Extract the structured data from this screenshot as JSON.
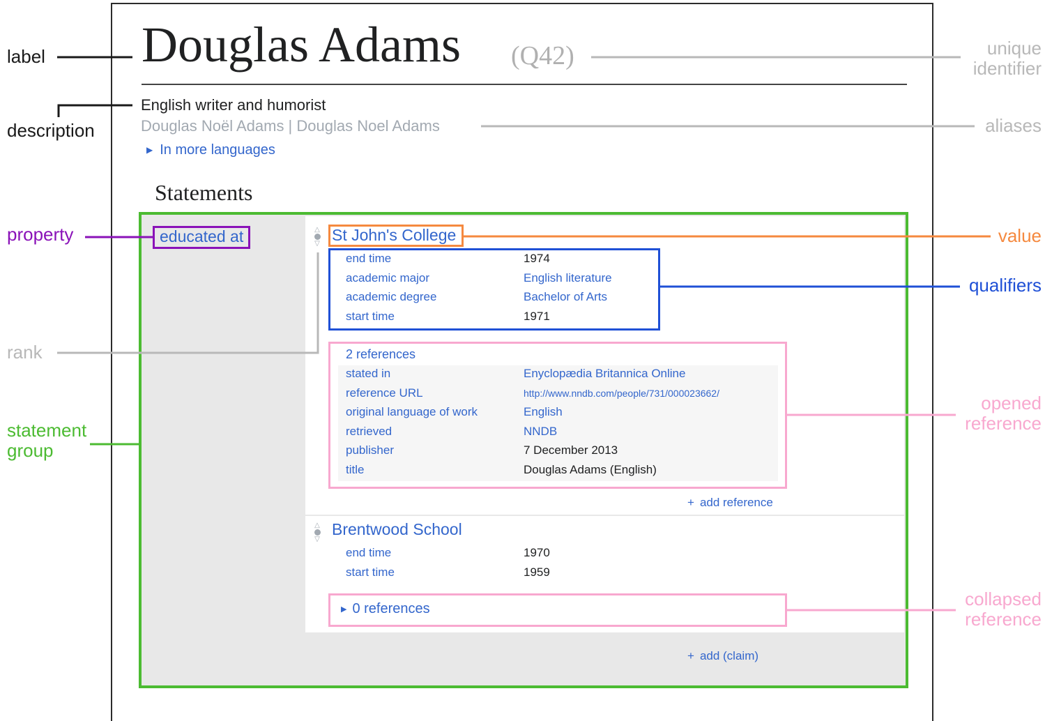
{
  "header": {
    "label": "Douglas Adams",
    "id": "(Q42)",
    "description": "English writer and humorist",
    "aliases": "Douglas Noël Adams | Douglas Noel Adams",
    "more_languages": "In more languages",
    "statements_heading": "Statements"
  },
  "statement_group": {
    "property": "educated at",
    "claims": [
      {
        "value": "St John's College",
        "qualifiers": [
          {
            "property": "end time",
            "value": "1974"
          },
          {
            "property": "academic major",
            "value": "English literature"
          },
          {
            "property": "academic degree",
            "value": "Bachelor of Arts"
          },
          {
            "property": "start time",
            "value": "1971"
          }
        ],
        "references_toggle": "2 references",
        "reference": [
          {
            "property": "stated in",
            "value": "Enyclopædia Britannica Online"
          },
          {
            "property": "reference URL",
            "value": "http://www.nndb.com/people/731/000023662/"
          },
          {
            "property": "original language of work",
            "value": "English"
          },
          {
            "property": "retrieved",
            "value": "NNDB"
          },
          {
            "property": "publisher",
            "value": "7 December 2013"
          },
          {
            "property": "title",
            "value": "Douglas Adams (English)"
          }
        ],
        "add_reference": "add reference"
      },
      {
        "value": "Brentwood School",
        "qualifiers": [
          {
            "property": "end time",
            "value": "1970"
          },
          {
            "property": "start time",
            "value": "1959"
          }
        ],
        "references_toggle": "0 references"
      }
    ],
    "add_claim": "add (claim)"
  },
  "annotations": {
    "label": "label",
    "description": "description",
    "property": "property",
    "rank": "rank",
    "statement_group_line1": "statement",
    "statement_group_line2": "group",
    "unique_identifier_line1": "unique",
    "unique_identifier_line2": "identifier",
    "aliases": "aliases",
    "value": "value",
    "qualifiers": "qualifiers",
    "opened_reference_line1": "opened",
    "opened_reference_line2": "reference",
    "collapsed_reference_line1": "collapsed",
    "collapsed_reference_line2": "reference"
  },
  "colors": {
    "label": "#1a1a1a",
    "unique_identifier": "#b8b8b8",
    "property": "#8a12b8",
    "value": "#f5893f",
    "qualifiers": "#1f50d6",
    "reference": "#f8a8cf",
    "statement_group": "#4cbb32",
    "rank": "#b8b8b8",
    "link": "#3366cc"
  }
}
